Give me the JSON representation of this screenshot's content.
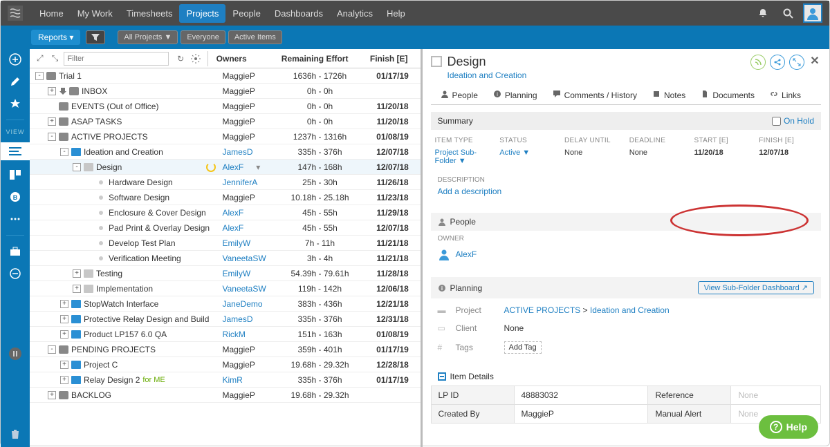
{
  "nav": {
    "items": [
      "Home",
      "My Work",
      "Timesheets",
      "Projects",
      "People",
      "Dashboards",
      "Analytics",
      "Help"
    ],
    "active": 3
  },
  "subbar": {
    "reports": "Reports ▾",
    "filters": [
      "All Projects ▼",
      "Everyone",
      "Active Items"
    ]
  },
  "grid": {
    "filter_placeholder": "Filter",
    "headers": {
      "owner": "Owners",
      "effort": "Remaining Effort",
      "finish": "Finish [E]"
    },
    "rows": [
      {
        "depth": 0,
        "exp": "-",
        "icon": "pkg",
        "name": "Trial 1",
        "owner": "MaggieP",
        "effort": "1636h - 1726h",
        "finish": "01/17/19"
      },
      {
        "depth": 1,
        "exp": "+",
        "dl": true,
        "icon": "pkg",
        "name": "INBOX",
        "owner": "MaggieP",
        "effort": "0h - 0h",
        "finish": ""
      },
      {
        "depth": 1,
        "exp": " ",
        "icon": "pkg",
        "name": "EVENTS (Out of Office)",
        "owner": "MaggieP",
        "effort": "0h - 0h",
        "finish": "11/20/18"
      },
      {
        "depth": 1,
        "exp": "+",
        "icon": "pkg",
        "name": "ASAP TASKS",
        "owner": "MaggieP",
        "effort": "0h - 0h",
        "finish": "11/20/18"
      },
      {
        "depth": 1,
        "exp": "-",
        "icon": "pkg",
        "name": "ACTIVE PROJECTS",
        "owner": "MaggieP",
        "effort": "1237h - 1316h",
        "finish": "01/08/19"
      },
      {
        "depth": 2,
        "exp": "-",
        "icon": "folder-blue",
        "name": "Ideation and Creation",
        "owner": "JamesD",
        "ownerLink": true,
        "effort": "335h - 376h",
        "finish": "12/07/18"
      },
      {
        "depth": 3,
        "exp": "-",
        "icon": "folder-grey",
        "name": "Design",
        "owner": "AlexF",
        "ownerLink": true,
        "ownerDrop": true,
        "effort": "147h - 168h",
        "finish": "12/07/18",
        "selected": true,
        "spin": true
      },
      {
        "depth": 4,
        "bullet": true,
        "name": "Hardware Design",
        "owner": "JenniferA",
        "ownerLink": true,
        "effort": "25h - 30h",
        "finish": "11/26/18"
      },
      {
        "depth": 4,
        "bullet": true,
        "name": "Software Design",
        "owner": "MaggieP",
        "effort": "10.18h - 25.18h",
        "finish": "11/23/18"
      },
      {
        "depth": 4,
        "bullet": true,
        "name": "Enclosure & Cover Design",
        "owner": "AlexF",
        "ownerLink": true,
        "effort": "45h - 55h",
        "finish": "11/29/18"
      },
      {
        "depth": 4,
        "bullet": true,
        "name": "Pad Print & Overlay Design",
        "owner": "AlexF",
        "ownerLink": true,
        "effort": "45h - 55h",
        "finish": "12/07/18"
      },
      {
        "depth": 4,
        "bullet": true,
        "name": "Develop Test Plan",
        "owner": "EmilyW",
        "ownerLink": true,
        "effort": "7h - 11h",
        "finish": "11/21/18"
      },
      {
        "depth": 4,
        "bullet": true,
        "name": "Verification Meeting",
        "owner": "VaneetaSW",
        "ownerLink": true,
        "effort": "3h - 4h",
        "finish": "11/21/18"
      },
      {
        "depth": 3,
        "exp": "+",
        "icon": "folder-grey",
        "name": "Testing",
        "owner": "EmilyW",
        "ownerLink": true,
        "effort": "54.39h - 79.61h",
        "finish": "11/28/18"
      },
      {
        "depth": 3,
        "exp": "+",
        "icon": "folder-grey",
        "name": "Implementation",
        "owner": "VaneetaSW",
        "ownerLink": true,
        "effort": "119h - 142h",
        "finish": "12/06/18"
      },
      {
        "depth": 2,
        "exp": "+",
        "icon": "folder-blue",
        "name": "StopWatch Interface",
        "owner": "JaneDemo",
        "ownerLink": true,
        "effort": "383h - 436h",
        "finish": "12/21/18"
      },
      {
        "depth": 2,
        "exp": "+",
        "icon": "folder-blue",
        "name": "Protective Relay Design and Build",
        "owner": "JamesD",
        "ownerLink": true,
        "effort": "335h - 376h",
        "finish": "12/31/18"
      },
      {
        "depth": 2,
        "exp": "+",
        "icon": "folder-blue",
        "name": "Product LP157 6.0 QA",
        "owner": "RickM",
        "ownerLink": true,
        "effort": "151h - 163h",
        "finish": "01/08/19"
      },
      {
        "depth": 1,
        "exp": "-",
        "icon": "pkg",
        "name": "PENDING PROJECTS",
        "owner": "MaggieP",
        "effort": "359h - 401h",
        "finish": "01/17/19"
      },
      {
        "depth": 2,
        "exp": "+",
        "icon": "folder-blue",
        "name": "Project C",
        "owner": "MaggieP",
        "effort": "19.68h - 29.32h",
        "finish": "12/28/18"
      },
      {
        "depth": 2,
        "exp": "+",
        "icon": "folder-blue",
        "name": "Relay Design 2",
        "forMe": "for ME",
        "owner": "KimR",
        "ownerLink": true,
        "effort": "335h - 376h",
        "finish": "01/17/19"
      },
      {
        "depth": 1,
        "exp": "+",
        "icon": "pkg",
        "name": "BACKLOG",
        "owner": "MaggieP",
        "effort": "19.68h - 29.32h",
        "finish": ""
      }
    ]
  },
  "view_label": "VIEW",
  "detail": {
    "title": "Design",
    "breadcrumb": "Ideation and Creation",
    "tabs": [
      "People",
      "Planning",
      "Comments / History",
      "Notes",
      "Documents",
      "Links"
    ],
    "summary_label": "Summary",
    "onhold_label": "On Hold",
    "summary": {
      "item_type_h": "ITEM TYPE",
      "item_type": "Project Sub-Folder ▼",
      "status_h": "STATUS",
      "status": "Active ▼",
      "delay_h": "DELAY UNTIL",
      "delay": "None",
      "deadline_h": "DEADLINE",
      "deadline": "None",
      "start_h": "START [E]",
      "start": "11/20/18",
      "finish_h": "FINISH [E]",
      "finish": "12/07/18"
    },
    "desc_h": "DESCRIPTION",
    "add_desc": "Add a description",
    "people_section": "People",
    "owner_h": "OWNER",
    "owner": "AlexF",
    "planning_section": "Planning",
    "view_dash": "View Sub-Folder Dashboard ↗",
    "plan": {
      "project_label": "Project",
      "bc1": "ACTIVE PROJECTS",
      "sep": " > ",
      "bc2": "Ideation and Creation",
      "client_label": "Client",
      "client": "None",
      "tags_label": "Tags",
      "tags_ph": "Add Tag"
    },
    "item_details_h": "Item Details",
    "details": {
      "lpid_l": "LP ID",
      "lpid": "48883032",
      "ref_l": "Reference",
      "ref": "None",
      "createdby_l": "Created By",
      "createdby": "MaggieP",
      "alert_l": "Manual Alert",
      "alert": "None"
    },
    "help": "Help"
  }
}
